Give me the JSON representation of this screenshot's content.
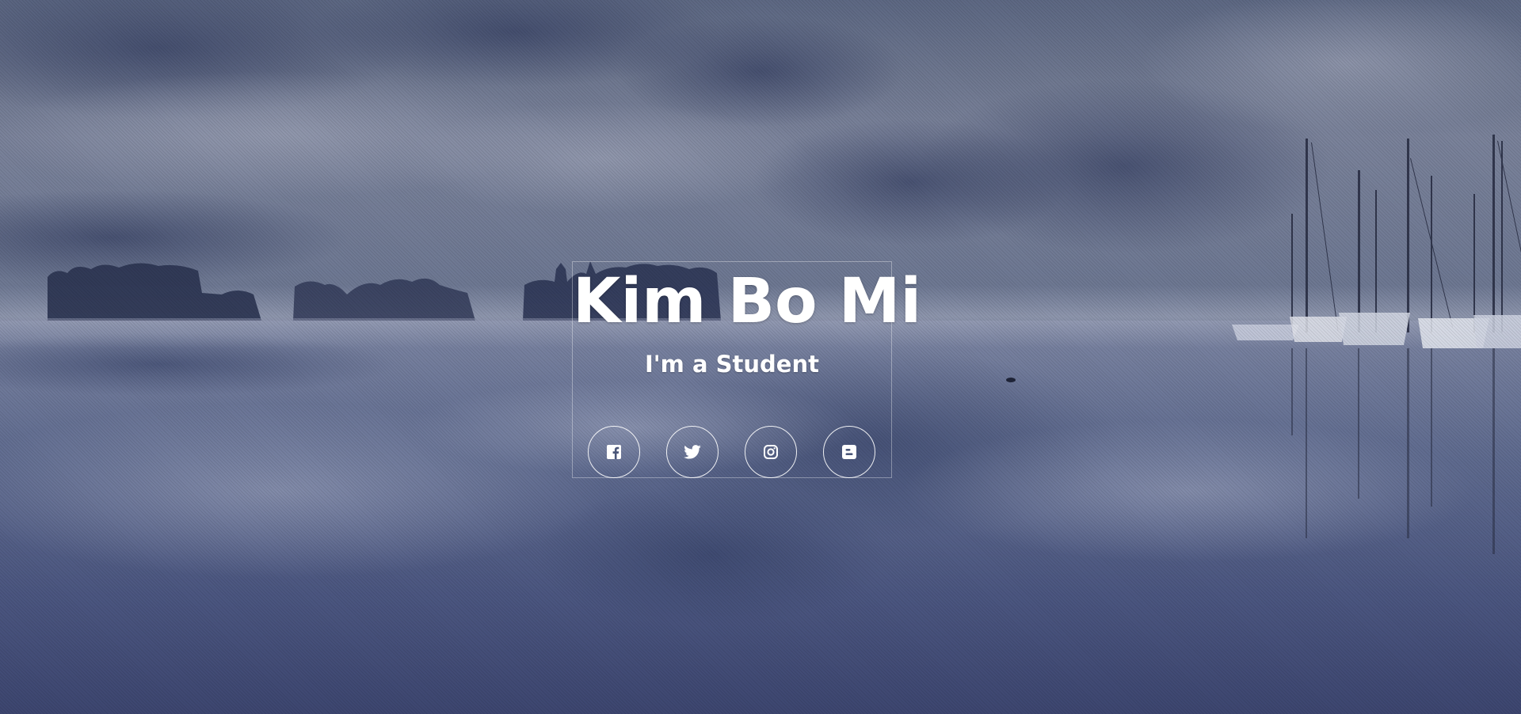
{
  "hero": {
    "name": "Kim Bo Mi",
    "role": "I'm a Student"
  },
  "social": [
    {
      "name": "facebook",
      "icon": "facebook-icon"
    },
    {
      "name": "twitter",
      "icon": "twitter-icon"
    },
    {
      "name": "instagram",
      "icon": "instagram-icon"
    },
    {
      "name": "blogger",
      "icon": "blogger-icon"
    }
  ],
  "colors": {
    "text": "#ffffff",
    "overlay": "#3c4a6e"
  }
}
